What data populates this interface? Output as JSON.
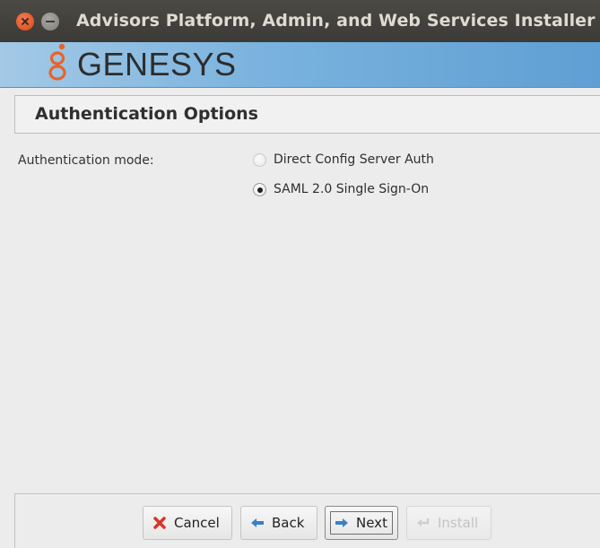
{
  "window": {
    "title": "Advisors Platform, Admin, and Web Services Installer"
  },
  "banner": {
    "logo_text": "GENESYS",
    "logo_color": "#e8632b"
  },
  "section": {
    "title": "Authentication Options"
  },
  "form": {
    "auth_mode_label": "Authentication mode:",
    "options": [
      {
        "label": "Direct Config Server Auth",
        "selected": false
      },
      {
        "label": "SAML 2.0 Single Sign-On",
        "selected": true
      }
    ]
  },
  "buttons": {
    "cancel": "Cancel",
    "back": "Back",
    "next": "Next",
    "install": "Install"
  },
  "colors": {
    "titlebar": "#3b3a36",
    "close": "#dd4814",
    "banner": "#79b2de",
    "icon_cancel": "#d9342b",
    "icon_arrow": "#3b7fc4"
  }
}
